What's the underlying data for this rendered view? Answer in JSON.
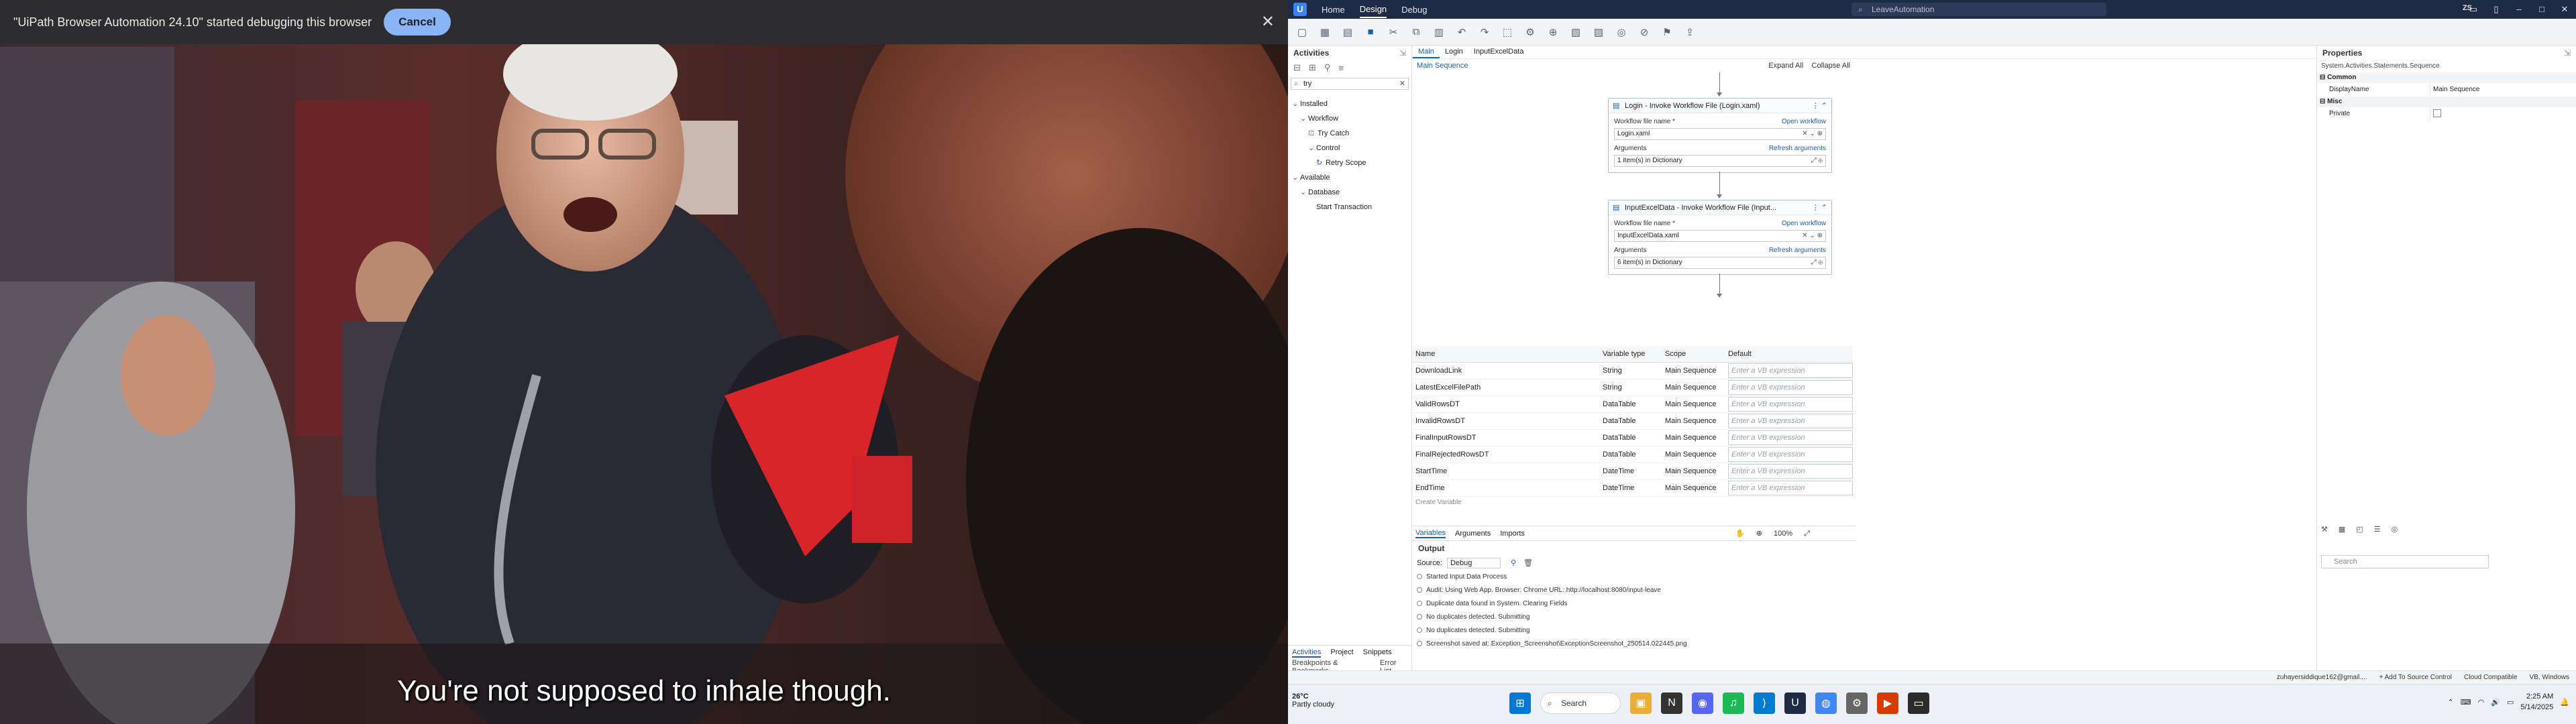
{
  "video": {
    "debug_message": "\"UiPath Browser Automation 24.10\" started debugging this browser",
    "cancel_label": "Cancel",
    "close_glyph": "✕",
    "subtitle": "You're not supposed to inhale though."
  },
  "studio": {
    "titlebar": {
      "tabs": [
        "Home",
        "Design",
        "Debug"
      ],
      "active_tab": "Design",
      "search": "LeaveAutomation",
      "user": "ZS"
    },
    "activities": {
      "title": "Activities",
      "search_value": "try",
      "tree": [
        {
          "label": "Installed",
          "indent": 0,
          "caret": "v"
        },
        {
          "label": "Workflow",
          "indent": 1,
          "caret": "v"
        },
        {
          "label": "Try Catch",
          "indent": 2,
          "caret": "",
          "icon": "try-catch-icon"
        },
        {
          "label": "Control",
          "indent": 2,
          "caret": "v"
        },
        {
          "label": "Retry Scope",
          "indent": 3,
          "caret": "",
          "icon": "retry-icon"
        },
        {
          "label": "Available",
          "indent": 0,
          "caret": "v"
        },
        {
          "label": "Database",
          "indent": 1,
          "caret": "v"
        },
        {
          "label": "Start Transaction",
          "indent": 2,
          "caret": ""
        }
      ],
      "bottom_tabs": [
        "Activities",
        "Project",
        "Snippets"
      ],
      "bottom_tabs2": [
        "Breakpoints & Bookmarks",
        "Error List"
      ]
    },
    "designer": {
      "doc_tabs": [
        "Main",
        "Login",
        "InputExcelData"
      ],
      "breadcrumb": "Main Sequence",
      "expand_all": "Expand All",
      "collapse_all": "Collapse All",
      "cards": [
        {
          "title": "Login - Invoke Workflow File (Login.xaml)",
          "file_label": "Workflow file name *",
          "open_link": "Open workflow",
          "file_value": "Login.xaml",
          "args_label": "Arguments",
          "refresh_link": "Refresh arguments",
          "args_value": "1 item(s) in Dictionary"
        },
        {
          "title": "InputExcelData - Invoke Workflow File (Input...",
          "file_label": "Workflow file name *",
          "open_link": "Open workflow",
          "file_value": "InputExcelData.xaml",
          "args_label": "Arguments",
          "refresh_link": "Refresh arguments",
          "args_value": "6 item(s) in Dictionary"
        }
      ]
    },
    "variables": {
      "headers": [
        "Name",
        "Variable type",
        "Scope",
        "Default"
      ],
      "rows": [
        {
          "name": "DownloadLink",
          "type": "String",
          "scope": "Main Sequence",
          "default": "Enter a VB expression"
        },
        {
          "name": "LatestExcelFilePath",
          "type": "String",
          "scope": "Main Sequence",
          "default": "Enter a VB expression"
        },
        {
          "name": "ValidRowsDT",
          "type": "DataTable",
          "scope": "Main Sequence",
          "default": "Enter a VB expression"
        },
        {
          "name": "InvalidRowsDT",
          "type": "DataTable",
          "scope": "Main Sequence",
          "default": "Enter a VB expression"
        },
        {
          "name": "FinalInputRowsDT",
          "type": "DataTable",
          "scope": "Main Sequence",
          "default": "Enter a VB expression"
        },
        {
          "name": "FinalRejectedRowsDT",
          "type": "DataTable",
          "scope": "Main Sequence",
          "default": "Enter a VB expression"
        },
        {
          "name": "StartTime",
          "type": "DateTime",
          "scope": "Main Sequence",
          "default": "Enter a VB expression"
        },
        {
          "name": "EndTime",
          "type": "DateTime",
          "scope": "Main Sequence",
          "default": "Enter a VB expression"
        }
      ],
      "create_label": "Create Variable",
      "bar_tabs": [
        "Variables",
        "Arguments",
        "Imports"
      ],
      "zoom": "100%"
    },
    "output": {
      "title": "Output",
      "source_label": "Source:",
      "source_value": "Debug",
      "logs": [
        "Started Input Data Process",
        "Audit: Using Web App. Browser: Chrome URL: http://localhost:8080/input-leave",
        "Duplicate data found in System. Clearing Fields",
        "No duplicates detected. Submitting",
        "No duplicates detected. Submitting",
        "Screenshot saved at: Exception_Screenshot\\ExceptionScreenshot_250514.022445.png"
      ]
    },
    "properties": {
      "title": "Properties",
      "type": "System.Activities.Statements.Sequence",
      "cat_common": "Common",
      "display_name_label": "DisplayName",
      "display_name_value": "Main Sequence",
      "cat_misc": "Misc",
      "private_label": "Private",
      "search_placeholder": "Search"
    },
    "statusbar": {
      "user": "zuhayersiddique162@gmail....",
      "source_control": "+ Add To Source Control",
      "cloud": "Cloud Compatible",
      "lang": "VB, Windows"
    }
  },
  "taskbar": {
    "temp": "26°C",
    "weather": "Partly cloudy",
    "search": "Search",
    "time": "2:25 AM",
    "date": "5/14/2025"
  }
}
